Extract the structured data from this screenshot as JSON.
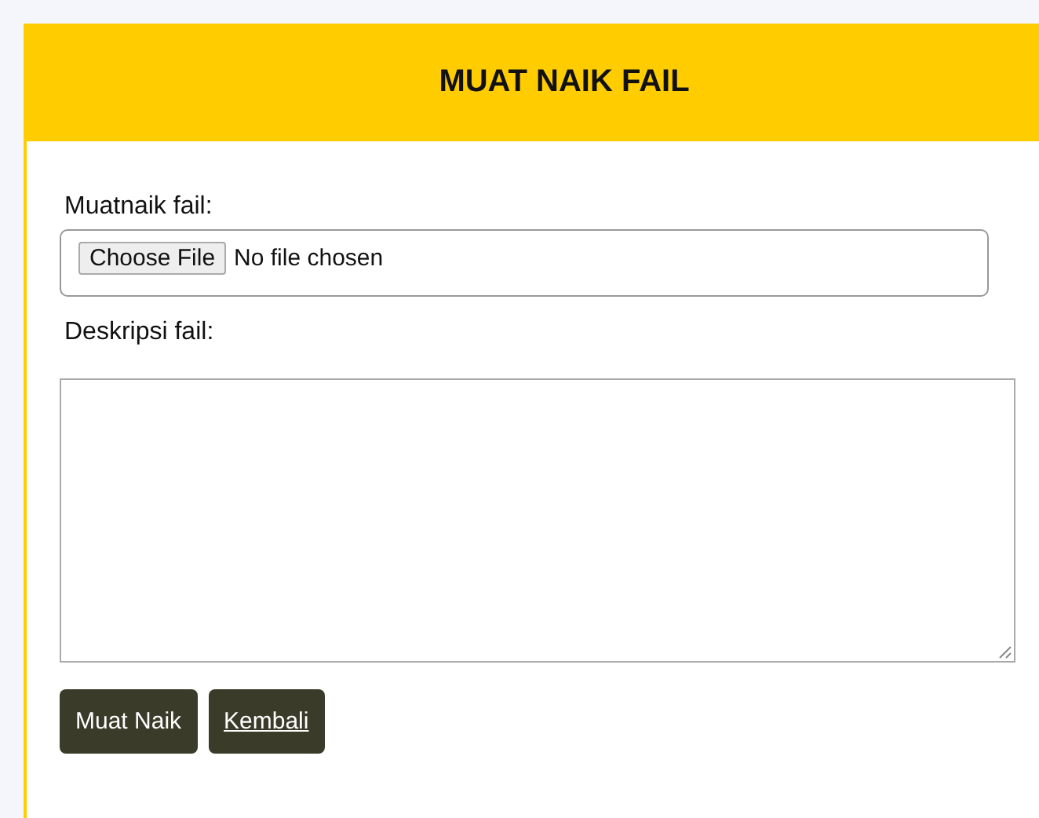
{
  "header": {
    "title": "MUAT NAIK FAIL"
  },
  "form": {
    "file_label": "Muatnaik fail:",
    "file_button": "Choose File",
    "file_status": "No file chosen",
    "description_label": "Deskripsi fail:"
  },
  "buttons": [
    {
      "label": "Muat Naik",
      "kind": "submit"
    },
    {
      "label": "Kembali",
      "kind": "link"
    }
  ]
}
